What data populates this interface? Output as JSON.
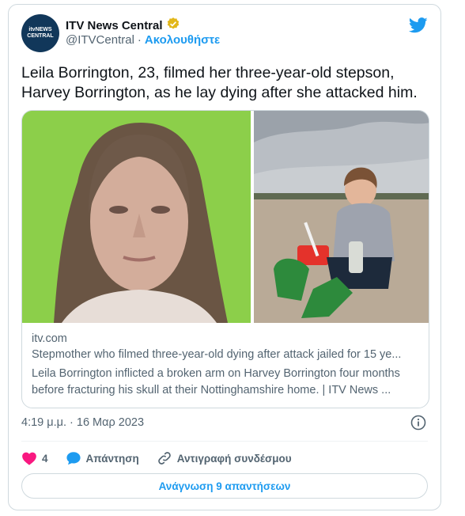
{
  "account": {
    "avatar_line1": "itvNEWS",
    "avatar_line2": "CENTRAL",
    "display_name": "ITV News Central",
    "handle": "@ITVCentral",
    "separator": "·",
    "follow_label": "Ακολουθήστε",
    "verified_icon": "verified-badge-icon",
    "platform_icon": "twitter-bird-icon"
  },
  "tweet": {
    "text": "Leila Borrington, 23, filmed her three-year-old stepson, Harvey Borrington, as he lay dying after she attacked him."
  },
  "card": {
    "domain": "itv.com",
    "title": "Stepmother who filmed three-year-old dying after attack jailed for 15 ye...",
    "description": "Leila Borrington inflicted a broken arm on Harvey Borrington four months before fracturing his skull at their Nottinghamshire home. | ITV News ..."
  },
  "meta": {
    "timestamp": "4:19 μ.μ. · 16 Μαρ 2023"
  },
  "actions": {
    "like_count": "4",
    "reply_label": "Απάντηση",
    "copy_link_label": "Αντιγραφή συνδέσμου"
  },
  "footer": {
    "read_replies_label": "Ανάγνωση 9 απαντήσεων"
  },
  "colors": {
    "accent": "#1d9bf0",
    "like": "#f91880",
    "muted": "#536471",
    "border": "#cfd9de"
  }
}
